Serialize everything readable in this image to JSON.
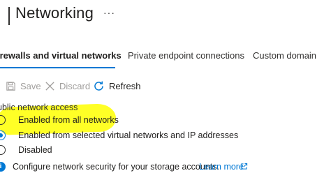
{
  "header": {
    "title": "Networking",
    "more": "···"
  },
  "tabs": [
    {
      "label": "irewalls and virtual networks",
      "active": true
    },
    {
      "label": "Private endpoint connections",
      "active": false
    },
    {
      "label": "Custom domain",
      "active": false
    }
  ],
  "toolbar": {
    "save_label": "Save",
    "discard_label": "Discard",
    "refresh_label": "Refresh"
  },
  "public_access": {
    "label": "ublic network access",
    "options": [
      {
        "label": "Enabled from all networks",
        "selected": false,
        "highlighted": true
      },
      {
        "label": "Enabled from selected virtual networks and IP addresses",
        "selected": true
      },
      {
        "label": "Disabled",
        "selected": false
      }
    ]
  },
  "info": {
    "text": "Configure network security for your storage accounts.",
    "link_label": "Learn more"
  },
  "colors": {
    "accent": "#0078d4",
    "highlight": "#ffff1a",
    "disabled": "#a19f9d"
  }
}
